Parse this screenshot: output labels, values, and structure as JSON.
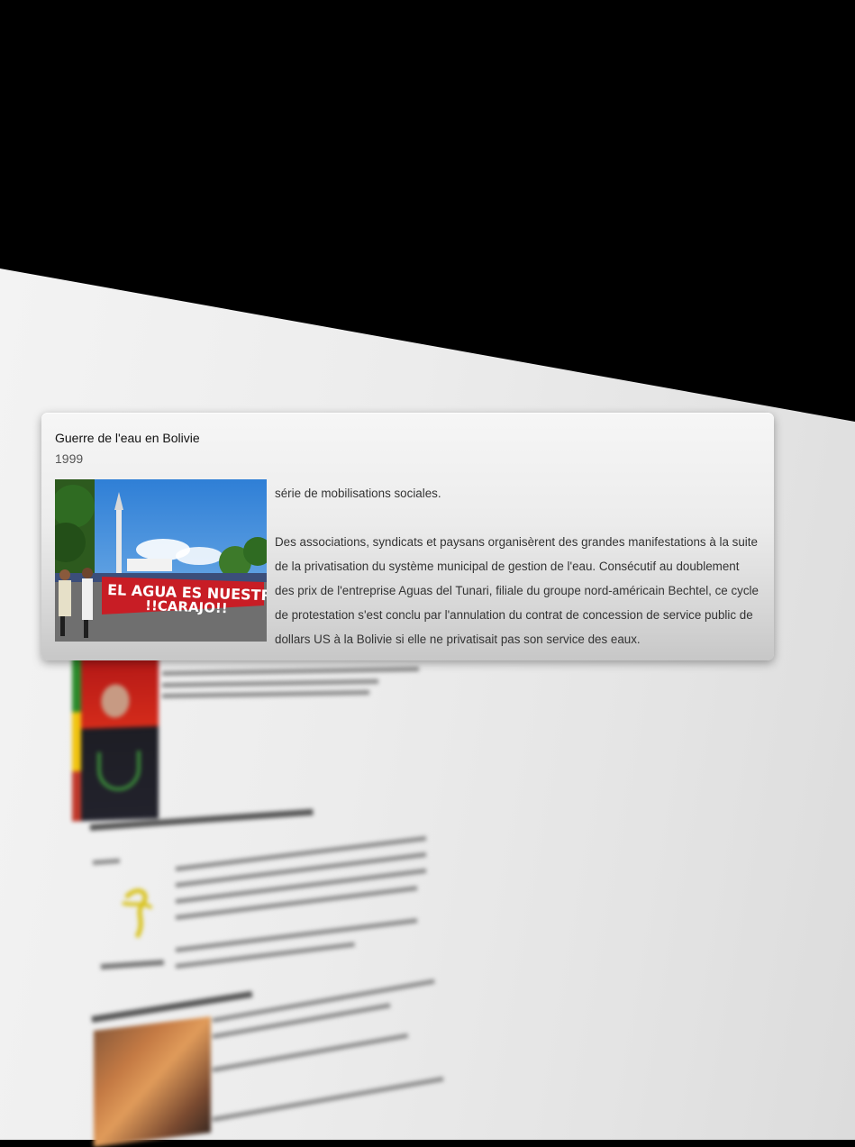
{
  "card": {
    "title": "Guerre de l'eau en Bolivie",
    "year": "1999",
    "image_banner_line1": "EL AGUA ES NUESTRA",
    "image_banner_line2": "!!CARAJO!!",
    "paragraph_1": "série de mobilisations sociales.",
    "paragraph_2": "Des associations, syndicats et paysans organisèrent des grandes manifestations à la suite de la privatisation du système municipal de gestion de l'eau. Consécutif au doublement des prix de l'entreprise Aguas del Tunari, filiale du groupe nord-américain Bechtel, ce cycle de protestation s'est conclu par l'annulation du contrat de concession de service public de dollars US à la Bolivie si elle ne privatisait pas son service des eaux."
  },
  "colors": {
    "banner_red": "#c81d25",
    "sky_blue": "#3d86d4",
    "background": "#000000",
    "surface": "#eeeeee"
  }
}
